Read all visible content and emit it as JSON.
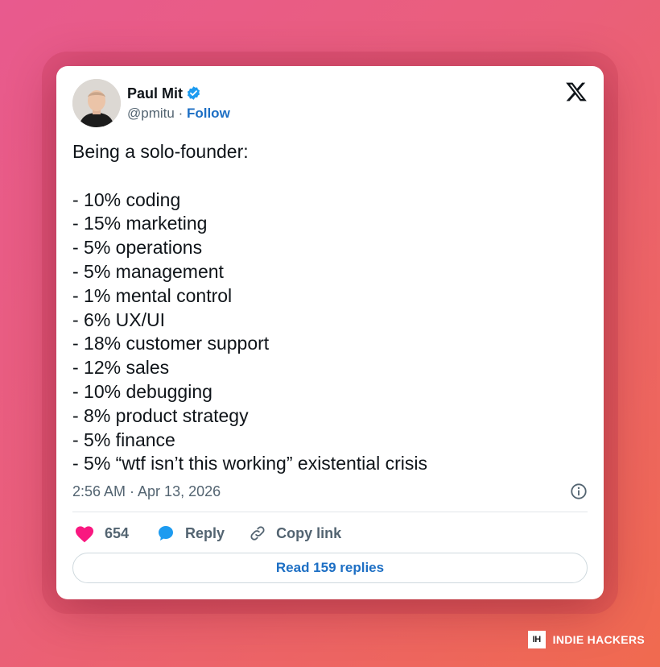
{
  "tweet": {
    "author_name": "Paul Mit",
    "handle": "@pmitu",
    "separator": "·",
    "follow_label": "Follow",
    "body": "Being a solo-founder:\n\n- 10% coding\n- 15% marketing\n- 5% operations\n- 5% management\n- 1% mental control\n- 6% UX/UI\n- 18% customer support\n- 12% sales\n- 10% debugging\n- 8% product strategy\n- 5% finance\n- 5% “wtf isn’t this working” existential crisis",
    "timestamp": "2:56 AM · Apr 13, 2026",
    "like_count": "654",
    "reply_label": "Reply",
    "copy_link_label": "Copy link",
    "read_replies_label": "Read 159 replies"
  },
  "branding": {
    "logo_letters": "IH",
    "name": "INDIE HACKERS"
  },
  "icons": {
    "verified": "verified-badge-icon",
    "platform": "x-logo-icon",
    "info": "info-icon",
    "like": "heart-icon",
    "reply": "speech-bubble-icon",
    "copy": "link-icon"
  },
  "colors": {
    "link_blue": "#1d6fc4",
    "verified_blue": "#1d9bf0",
    "heart_pink": "#f91880",
    "muted_text": "#536471"
  }
}
